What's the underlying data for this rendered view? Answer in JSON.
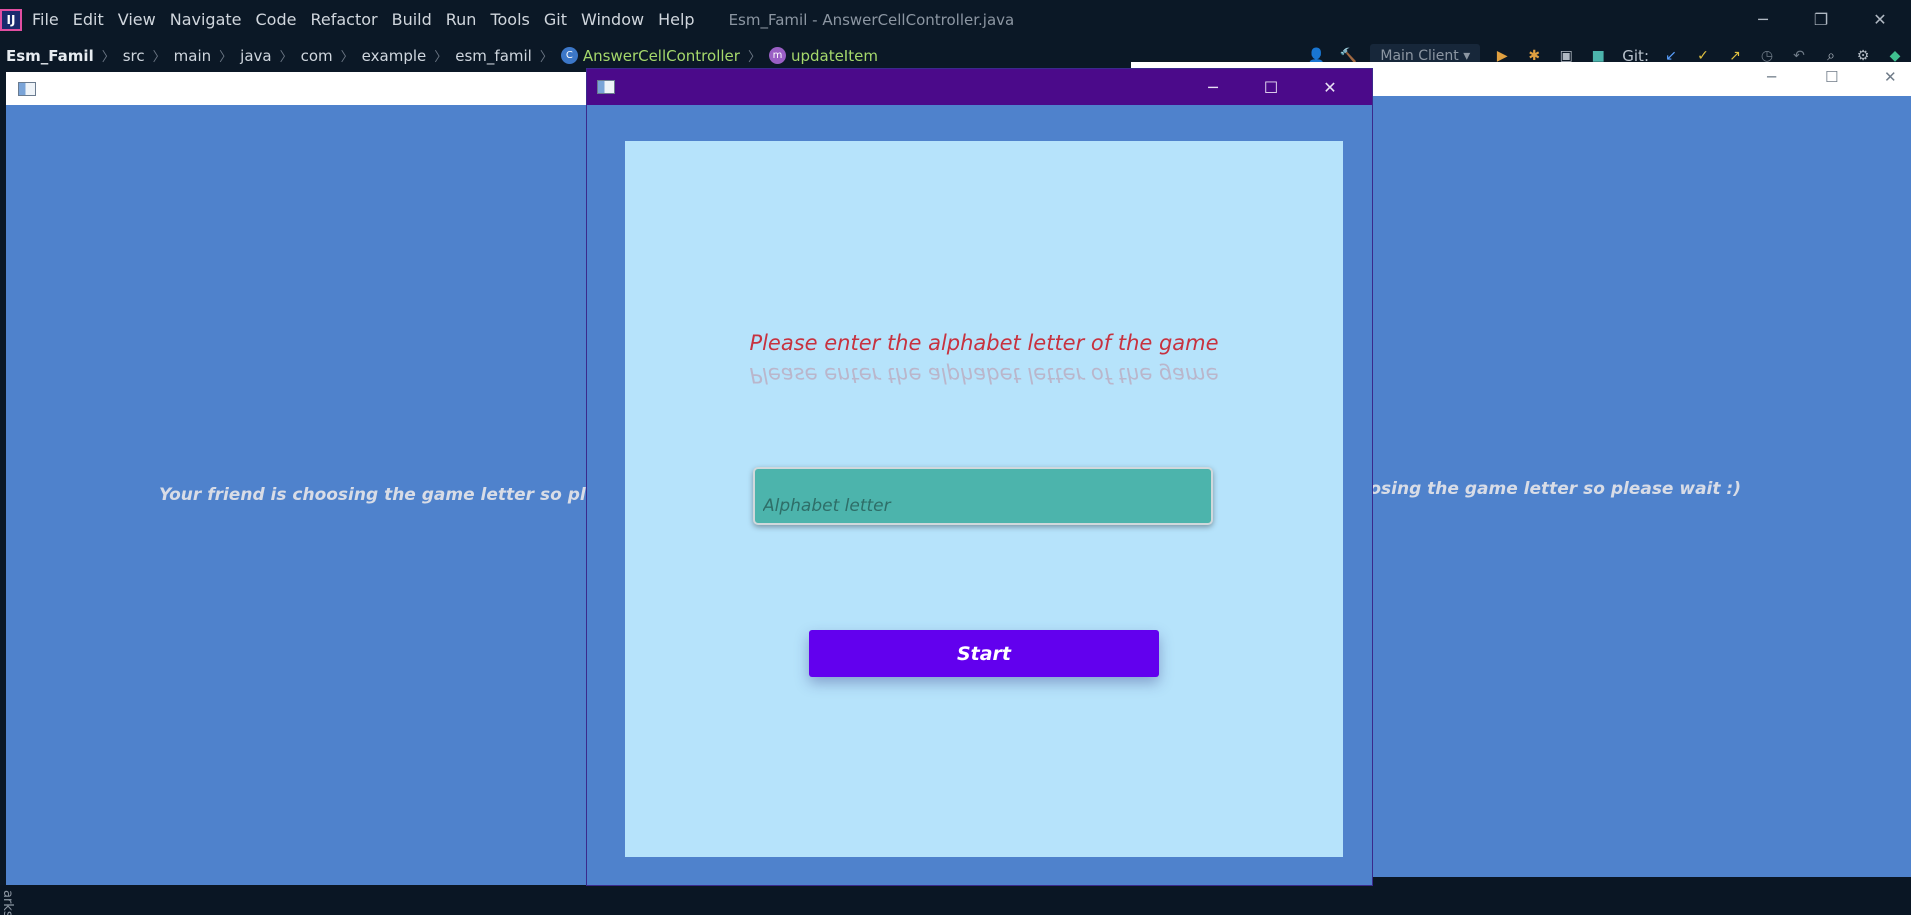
{
  "ide": {
    "window_title": "Esm_Famil - AnswerCellController.java",
    "menu": [
      "File",
      "Edit",
      "View",
      "Navigate",
      "Code",
      "Refactor",
      "Build",
      "Run",
      "Tools",
      "Git",
      "Window",
      "Help"
    ],
    "breadcrumb": {
      "project": "Esm_Famil",
      "path": [
        "src",
        "main",
        "java",
        "com",
        "example",
        "esm_famil"
      ],
      "class_name": "AnswerCellController",
      "class_icon_letter": "C",
      "method_name": "updateItem",
      "method_icon_letter": "m"
    },
    "run_config": "Main Client",
    "git_label": "Git:",
    "bottom_label": "arks",
    "logo_letter": "IJ"
  },
  "background_windows": {
    "left_text": "Your friend is choosing the game letter so please wait :)",
    "right_text": "Your friend is choosing the game letter so please wait :)"
  },
  "dialog": {
    "prompt": "Please enter the alphabet letter of the game",
    "input_placeholder": "Alphabet letter",
    "input_value": "",
    "start_label": "Start"
  },
  "colors": {
    "accent": "#6200ee",
    "titlebar": "#4b0a8a",
    "prompt": "#c7323f",
    "panel": "#b6e3fb",
    "window_bg": "#4f82cc",
    "input_bg": "#4cb4ac"
  },
  "icons": [
    "minimize-icon",
    "maximize-icon",
    "close-icon",
    "app-window-icon",
    "run-icon",
    "debug-icon",
    "hammer-icon",
    "search-icon",
    "settings-icon"
  ]
}
